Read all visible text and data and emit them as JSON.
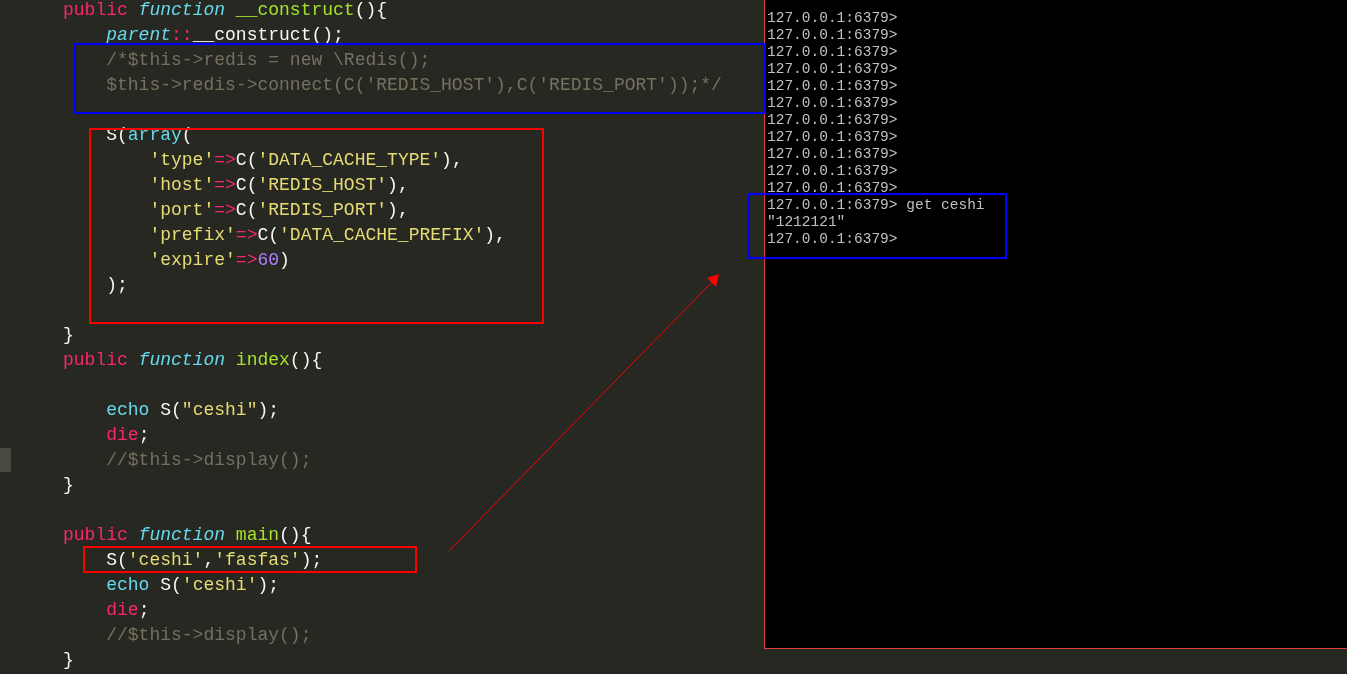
{
  "editor": {
    "blocks": [
      {
        "lines": [
          [
            {
              "kind": "keyword",
              "text": "public "
            },
            {
              "kind": "storage",
              "text": "function "
            },
            {
              "kind": "name",
              "text": "__construct"
            },
            {
              "kind": "plain",
              "text": "(){"
            }
          ],
          [
            {
              "kind": "storage",
              "text": "    parent"
            },
            {
              "kind": "keyword",
              "text": "::"
            },
            {
              "kind": "plain",
              "text": "__construct();"
            }
          ],
          [
            {
              "kind": "comment",
              "text": "    /*$this->redis = new \\Redis();"
            }
          ],
          [
            {
              "kind": "comment",
              "text": "    $this->redis->connect(C('REDIS_HOST'),C('REDIS_PORT'));*/"
            }
          ]
        ]
      },
      {
        "lines": [
          [
            {
              "kind": "plain",
              "text": "    S("
            },
            {
              "kind": "builtin",
              "text": "array"
            },
            {
              "kind": "plain",
              "text": "("
            }
          ],
          [
            {
              "kind": "string",
              "text": "        'type'"
            },
            {
              "kind": "keyword",
              "text": "=>"
            },
            {
              "kind": "plain",
              "text": "C("
            },
            {
              "kind": "string",
              "text": "'DATA_CACHE_TYPE'"
            },
            {
              "kind": "plain",
              "text": "),"
            }
          ],
          [
            {
              "kind": "string",
              "text": "        'host'"
            },
            {
              "kind": "keyword",
              "text": "=>"
            },
            {
              "kind": "plain",
              "text": "C("
            },
            {
              "kind": "string",
              "text": "'REDIS_HOST'"
            },
            {
              "kind": "plain",
              "text": "),"
            }
          ],
          [
            {
              "kind": "string",
              "text": "        'port'"
            },
            {
              "kind": "keyword",
              "text": "=>"
            },
            {
              "kind": "plain",
              "text": "C("
            },
            {
              "kind": "string",
              "text": "'REDIS_PORT'"
            },
            {
              "kind": "plain",
              "text": "),"
            }
          ],
          [
            {
              "kind": "string",
              "text": "        'prefix'"
            },
            {
              "kind": "keyword",
              "text": "=>"
            },
            {
              "kind": "plain",
              "text": "C("
            },
            {
              "kind": "string",
              "text": "'DATA_CACHE_PREFIX'"
            },
            {
              "kind": "plain",
              "text": "),"
            }
          ],
          [
            {
              "kind": "string",
              "text": "        'expire'"
            },
            {
              "kind": "keyword",
              "text": "=>"
            },
            {
              "kind": "number",
              "text": "60"
            },
            {
              "kind": "plain",
              "text": ")"
            }
          ],
          [
            {
              "kind": "plain",
              "text": "    );"
            }
          ]
        ]
      },
      {
        "lines": [
          [
            {
              "kind": "plain",
              "text": "}"
            }
          ],
          [
            {
              "kind": "keyword",
              "text": "public "
            },
            {
              "kind": "storage",
              "text": "function "
            },
            {
              "kind": "name",
              "text": "index"
            },
            {
              "kind": "plain",
              "text": "(){"
            }
          ]
        ]
      },
      {
        "lines": [
          [
            {
              "kind": "builtin",
              "text": "    echo"
            },
            {
              "kind": "plain",
              "text": " S("
            },
            {
              "kind": "string",
              "text": "\"ceshi\""
            },
            {
              "kind": "plain",
              "text": ");"
            }
          ],
          [
            {
              "kind": "keyword",
              "text": "    die"
            },
            {
              "kind": "plain",
              "text": ";"
            }
          ],
          [
            {
              "kind": "comment",
              "text": "    //$this->display();"
            }
          ],
          [
            {
              "kind": "plain",
              "text": "}"
            }
          ]
        ]
      },
      {
        "lines": [
          [
            {
              "kind": "keyword",
              "text": "public "
            },
            {
              "kind": "storage",
              "text": "function "
            },
            {
              "kind": "name",
              "text": "main"
            },
            {
              "kind": "plain",
              "text": "(){"
            }
          ],
          [
            {
              "kind": "plain",
              "text": "    S("
            },
            {
              "kind": "string",
              "text": "'ceshi'"
            },
            {
              "kind": "plain",
              "text": ","
            },
            {
              "kind": "string",
              "text": "'fasfas'"
            },
            {
              "kind": "plain",
              "text": ");"
            }
          ],
          [
            {
              "kind": "builtin",
              "text": "    echo"
            },
            {
              "kind": "plain",
              "text": " S("
            },
            {
              "kind": "string",
              "text": "'ceshi'"
            },
            {
              "kind": "plain",
              "text": ");"
            }
          ],
          [
            {
              "kind": "keyword",
              "text": "    die"
            },
            {
              "kind": "plain",
              "text": ";"
            }
          ],
          [
            {
              "kind": "comment",
              "text": "    //$this->display();"
            }
          ],
          [
            {
              "kind": "plain",
              "text": "}"
            }
          ]
        ]
      }
    ]
  },
  "terminal": {
    "lines": [
      "127.0.0.1:6379>",
      "127.0.0.1:6379>",
      "127.0.0.1:6379>",
      "127.0.0.1:6379>",
      "127.0.0.1:6379>",
      "127.0.0.1:6379>",
      "127.0.0.1:6379>",
      "127.0.0.1:6379>",
      "127.0.0.1:6379>",
      "127.0.0.1:6379>",
      "127.0.0.1:6379>",
      "127.0.0.1:6379> get ceshi",
      "\"1212121\"",
      "127.0.0.1:6379>"
    ]
  },
  "annotations": [
    {
      "kind": "frame",
      "color": "#0000ff"
    },
    {
      "kind": "frame",
      "color": "#ff0000"
    },
    {
      "kind": "frame",
      "color": "#ff0000"
    },
    {
      "kind": "frame",
      "color": "#0000ff"
    },
    {
      "kind": "arrow",
      "color": "#ff0000"
    }
  ]
}
